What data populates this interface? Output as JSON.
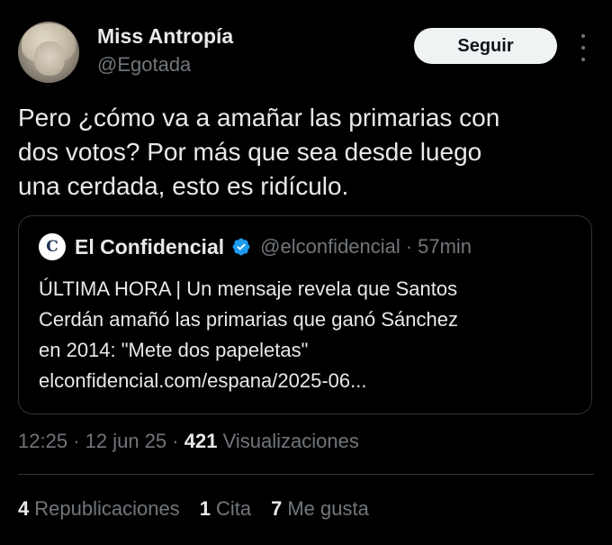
{
  "author": {
    "name": "Miss Antropía",
    "handle": "@Egotada"
  },
  "actions": {
    "follow_label": "Seguir",
    "more_icon": "more-vertical-icon"
  },
  "tweet": {
    "lines": [
      "Pero ¿cómo va a amañar las primarias con",
      "dos votos? Por más que sea desde luego",
      "una cerdada, esto es ridículo."
    ]
  },
  "quote": {
    "avatar_letter": "C",
    "name": "El Confidencial",
    "verified_icon": "verified-badge-icon",
    "handle": "@elconfidencial",
    "separator": "·",
    "time": "57min",
    "lines": [
      "ÚLTIMA HORA | Un mensaje revela que Santos",
      "Cerdán amañó las primarias que ganó Sánchez",
      "en 2014: \"Mete dos papeletas\"",
      "elconfidencial.com/espana/2025-06..."
    ]
  },
  "meta": {
    "time": "12:25",
    "sep1": "·",
    "date": "12 jun 25",
    "sep2": "·",
    "views_count": "421",
    "views_label": "Visualizaciones"
  },
  "stats": {
    "reposts_count": "4",
    "reposts_label": "Republicaciones",
    "quotes_count": "1",
    "quotes_label": "Cita",
    "likes_count": "7",
    "likes_label": "Me gusta"
  },
  "colors": {
    "background": "#000000",
    "text": "#e7e9ea",
    "secondary": "#71767b",
    "border": "#2f3336",
    "verified": "#1d9bf0",
    "button_bg": "#eff3f4"
  }
}
